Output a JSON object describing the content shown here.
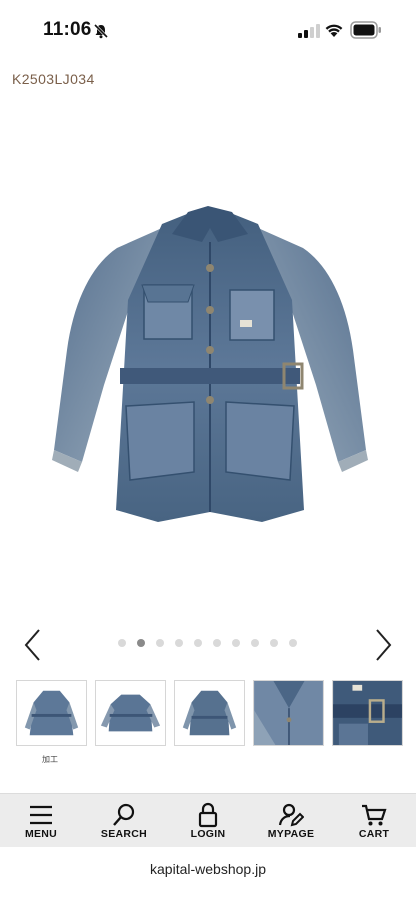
{
  "status_bar": {
    "time": "11:06",
    "icons": [
      "bell-slash-icon",
      "cellular-signal-icon",
      "wifi-icon",
      "battery-icon"
    ]
  },
  "product": {
    "code": "K2503LJ034"
  },
  "carousel": {
    "total_slides": 10,
    "active_index": 1,
    "prev_icon": "chevron-left-icon",
    "next_icon": "chevron-right-icon"
  },
  "thumbnails": {
    "count": 5,
    "caption": "加工"
  },
  "bottom_nav": {
    "items": [
      {
        "label": "MENU",
        "icon": "hamburger-menu-icon"
      },
      {
        "label": "SEARCH",
        "icon": "search-icon"
      },
      {
        "label": "LOGIN",
        "icon": "lock-icon"
      },
      {
        "label": "MYPAGE",
        "icon": "user-pencil-icon"
      },
      {
        "label": "CART",
        "icon": "cart-icon"
      }
    ]
  },
  "browser": {
    "url": "kapital-webshop.jp"
  },
  "colors": {
    "product_code": "#7a5f4a",
    "denim_dark": "#3f5877",
    "denim_mid": "#5c7595",
    "denim_light": "#8fa2b6",
    "nav_background": "#ececec",
    "dot_active": "#8a8a8a",
    "dot_inactive": "#d9d9d9"
  }
}
